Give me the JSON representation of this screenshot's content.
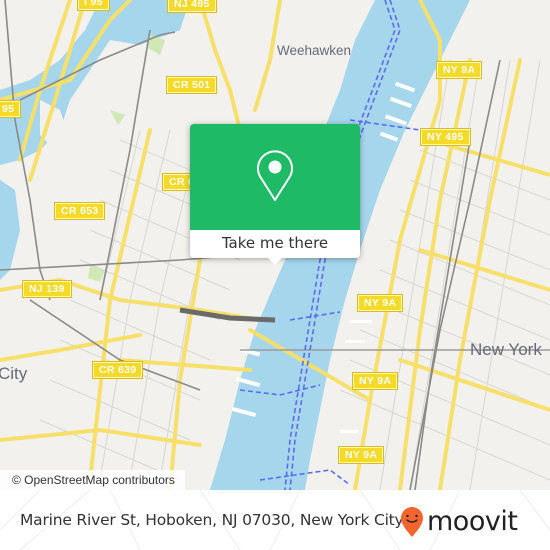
{
  "map": {
    "place_labels": [
      {
        "id": "weehawken",
        "text": "Weehawken"
      },
      {
        "id": "new-york",
        "text": "New York"
      },
      {
        "id": "city",
        "text": "City"
      }
    ],
    "road_shields": [
      {
        "id": "i95-top",
        "text": "I 95"
      },
      {
        "id": "nj495",
        "text": "NJ 495"
      },
      {
        "id": "i95-left",
        "text": "95"
      },
      {
        "id": "cr501",
        "text": "CR 501"
      },
      {
        "id": "ny9a-top",
        "text": "NY 9A"
      },
      {
        "id": "ny495",
        "text": "NY 495"
      },
      {
        "id": "cr-partial",
        "text": "CR 6"
      },
      {
        "id": "cr653",
        "text": "CR 653"
      },
      {
        "id": "nj139",
        "text": "NJ 139"
      },
      {
        "id": "ny9a-mid1",
        "text": "NY 9A"
      },
      {
        "id": "cr639",
        "text": "CR 639"
      },
      {
        "id": "ny9a-mid2",
        "text": "NY 9A"
      },
      {
        "id": "ny9a-bottom",
        "text": "NY 9A"
      }
    ],
    "attribution": "© OpenStreetMap contributors",
    "colors": {
      "land": "#f2f1ed",
      "water": "#a5d6ec",
      "road": "#f7e06a",
      "ferry": "#5a6cf0",
      "rail": "#8a8a8a",
      "park": "#cfe8b4"
    }
  },
  "popup": {
    "icon": "location-pin-icon",
    "button_label": "Take me there",
    "color": "#1fba66"
  },
  "footer": {
    "address": "Marine River St, Hoboken, NJ 07030, New York City",
    "brand": "moovit",
    "brand_icon": "moovit-pin-logo-icon",
    "brand_color": "#f26430"
  }
}
